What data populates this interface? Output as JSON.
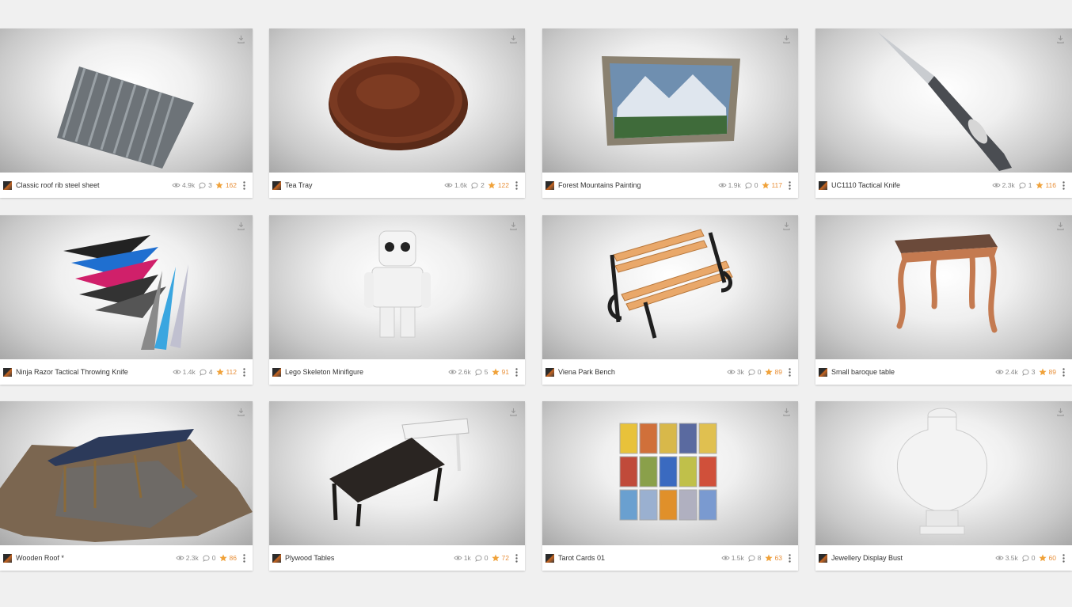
{
  "colors": {
    "accent_star": "#f0a23a",
    "title_text": "#333333",
    "stat_text": "#8a8a8a",
    "page_bg": "#f0f0f0"
  },
  "icons": {
    "download": "download-icon",
    "views": "eye-icon",
    "comments": "comment-icon",
    "likes": "star-icon",
    "menu": "more-vertical-icon"
  },
  "models": [
    {
      "title": "Classic roof rib steel sheet",
      "views": "4.9k",
      "comments": "3",
      "likes": "162"
    },
    {
      "title": "Tea Tray",
      "views": "1.6k",
      "comments": "2",
      "likes": "122"
    },
    {
      "title": "Forest Mountains Painting",
      "views": "1.9k",
      "comments": "0",
      "likes": "117"
    },
    {
      "title": "UC1110 Tactical Knife",
      "views": "2.3k",
      "comments": "1",
      "likes": "116"
    },
    {
      "title": "Ninja Razor Tactical Throwing Knife",
      "views": "1.4k",
      "comments": "4",
      "likes": "112"
    },
    {
      "title": "Lego Skeleton Minifigure",
      "views": "2.6k",
      "comments": "5",
      "likes": "91"
    },
    {
      "title": "Viena Park Bench",
      "views": "3k",
      "comments": "0",
      "likes": "89"
    },
    {
      "title": "Small baroque table",
      "views": "2.4k",
      "comments": "3",
      "likes": "89"
    },
    {
      "title": "Wooden Roof *",
      "views": "2.3k",
      "comments": "0",
      "likes": "86"
    },
    {
      "title": "Plywood Tables",
      "views": "1k",
      "comments": "0",
      "likes": "72"
    },
    {
      "title": "Tarot Cards 01",
      "views": "1.5k",
      "comments": "8",
      "likes": "63"
    },
    {
      "title": "Jewellery Display Bust",
      "views": "3.5k",
      "comments": "0",
      "likes": "60"
    }
  ]
}
